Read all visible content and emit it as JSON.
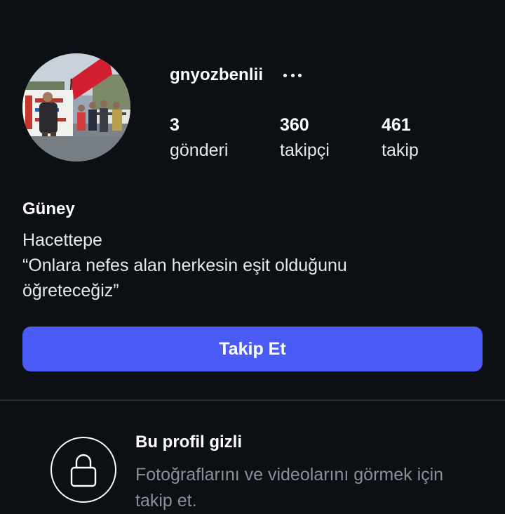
{
  "profile": {
    "username": "gnyozbenlii",
    "display_name": "Güney",
    "bio_lines": [
      "Hacettepe",
      "“Onlara nefes alan herkesin eşit olduğunu",
      "öğreteceğiz”"
    ],
    "avatar": "protest-march-photo"
  },
  "stats": {
    "posts": {
      "count": "3",
      "label": "gönderi"
    },
    "followers": {
      "count": "360",
      "label": "takipçi"
    },
    "following": {
      "count": "461",
      "label": "takip"
    }
  },
  "actions": {
    "follow_label": "Takip Et",
    "more_icon": "more-horizontal-icon"
  },
  "private_notice": {
    "title": "Bu profil gizli",
    "description": "Fotoğraflarını ve videolarını görmek için takip et.",
    "icon": "lock-icon"
  },
  "colors": {
    "background": "#0c0f14",
    "accent": "#4a5cf5",
    "muted_text": "#8a8f98",
    "divider": "#2a2e35"
  }
}
